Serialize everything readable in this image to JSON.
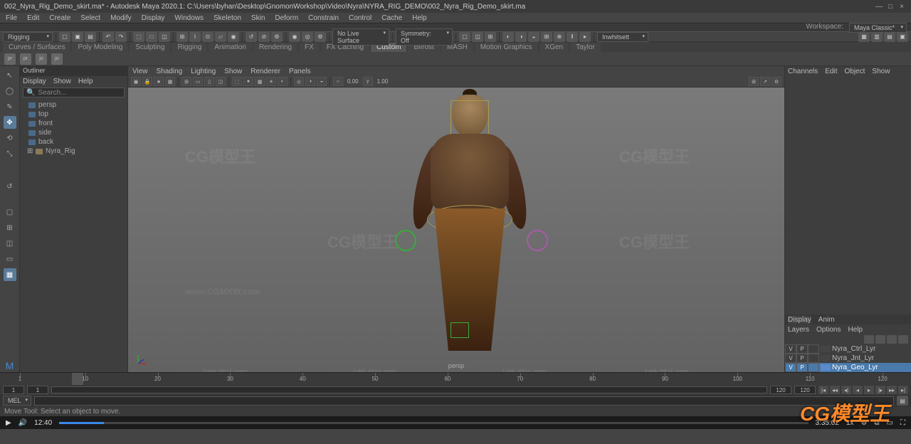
{
  "title": "002_Nyra_Rig_Demo_skirt.ma* - Autodesk Maya 2020.1: C:\\Users\\byhan\\Desktop\\GnomonWorkshop\\Video\\Nyra\\NYRA_RIG_DEMO\\002_Nyra_Rig_Demo_skirt.ma",
  "menubar": [
    "File",
    "Edit",
    "Create",
    "Select",
    "Modify",
    "Display",
    "Windows",
    "Skeleton",
    "Skin",
    "Deform",
    "Constrain",
    "Control",
    "Cache",
    "Help"
  ],
  "statusline": {
    "workspace_label": "Workspace:",
    "workspace_value": "Maya Classic*",
    "module": "Rigging",
    "live_surface": "No Live Surface",
    "symmetry": "Symmetry: Off",
    "input": "Inwhitsett"
  },
  "shelf_tabs": [
    "Curves / Surfaces",
    "Poly Modeling",
    "Sculpting",
    "Rigging",
    "Animation",
    "Rendering",
    "FX",
    "FX Caching",
    "Custom",
    "Bifrost",
    "MASH",
    "Motion Graphics",
    "XGen",
    "Taylor"
  ],
  "shelf_active": "Custom",
  "shelf_icons": [
    "prtSep",
    "prtSep",
    "joiMT",
    "joiMT"
  ],
  "outliner": {
    "title": "Outliner",
    "menus": [
      "Display",
      "Show",
      "Help"
    ],
    "search_placeholder": "Search...",
    "nodes": [
      {
        "icon": "cam",
        "label": "persp"
      },
      {
        "icon": "cam",
        "label": "top"
      },
      {
        "icon": "cam",
        "label": "front"
      },
      {
        "icon": "cam",
        "label": "side"
      },
      {
        "icon": "cam",
        "label": "back"
      },
      {
        "icon": "grp",
        "label": "Nyra_Rig"
      }
    ]
  },
  "viewport": {
    "menus": [
      "View",
      "Shading",
      "Lighting",
      "Show",
      "Renderer",
      "Panels"
    ],
    "exposure": "0.00",
    "gamma": "1.00",
    "camera": "persp"
  },
  "right": {
    "tabs": [
      "Channels",
      "Edit",
      "Object",
      "Show"
    ],
    "layer_tabs": [
      "Display",
      "Anim"
    ],
    "layer_menus": [
      "Layers",
      "Options",
      "Help"
    ],
    "layers": [
      {
        "v": "V",
        "p": "P",
        "color": "#444",
        "name": "Nyra_Ctrl_Lyr",
        "sel": false
      },
      {
        "v": "V",
        "p": "P",
        "color": "#444",
        "name": "Nyra_Jnt_Lyr",
        "sel": false
      },
      {
        "v": "V",
        "p": "P",
        "color": "#5a8aca",
        "name": "Nyra_Geo_Lyr",
        "sel": true
      }
    ]
  },
  "timeline": {
    "ticks": [
      1,
      10,
      20,
      30,
      40,
      50,
      60,
      70,
      80,
      90,
      100,
      110,
      120
    ],
    "current": 1,
    "range_start": "1",
    "range_end": "120",
    "range_start2": "1",
    "range_end2": "120"
  },
  "mel_label": "MEL",
  "hint": "Move Tool: Select an object to move.",
  "video": {
    "cur": "12:40",
    "dur": "3:35:02"
  },
  "watermark_brand": "CG模型王",
  "watermark_url": "www.CGMXW.com"
}
